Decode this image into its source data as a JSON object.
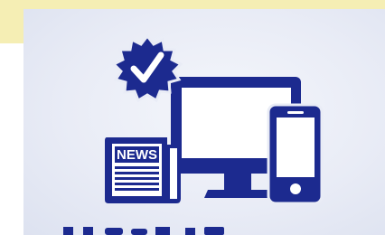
{
  "icons": {
    "badge": "check-badge-icon",
    "newspaper": "newspaper-icon",
    "monitor": "desktop-monitor-icon",
    "phone": "smartphone-icon"
  },
  "newspaper": {
    "masthead": "NEWS"
  },
  "colors": {
    "icon_blue": "#1c2a8f",
    "top_band": "#f5eeb4",
    "card_bg": "#e9ecf6"
  }
}
